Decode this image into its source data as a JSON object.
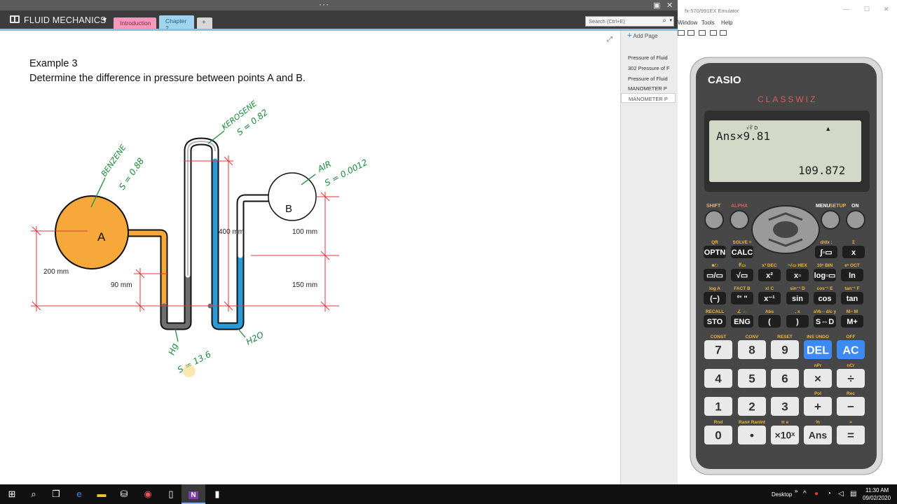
{
  "onenote": {
    "notebook_title": "FLUID MECHANICS",
    "sections": [
      "Introduction",
      "Chapter 2",
      "+"
    ],
    "search_placeholder": "Search (Ctrl+E)",
    "add_page_label": "Add Page",
    "pages": [
      "Pressure of Fluid",
      "302 Pressure of F",
      "Pressure of Fluid",
      "MANOMETER P",
      "MANOMETER P"
    ],
    "selected_page_index": 4,
    "page": {
      "heading": "Example 3",
      "problem": "Determine the difference in pressure between points A and B.",
      "diagram": {
        "point_a": "A",
        "point_b": "B",
        "dimensions": [
          "200 mm",
          "90 mm",
          "400 mm",
          "100 mm",
          "150 mm"
        ],
        "handwritten": [
          "BENZENE",
          "S = 0.88",
          "KEROSENE",
          "S = 0.82",
          "AIR",
          "S = 0.0012",
          "Hg",
          "S = 13.6",
          "H2O"
        ],
        "colors": {
          "benzene": "#f7a83a",
          "water": "#2a9bd7",
          "mercury": "#6e6e6e",
          "air": "#ffffff",
          "dimension_lines": "#e2343e",
          "ink": "#1a8a3a"
        }
      }
    }
  },
  "emulator": {
    "window_title": "fx-570/991EX Emulator",
    "menu": [
      "Window",
      "Tools",
      "Help"
    ],
    "calculator": {
      "brand": "CASIO",
      "model": "CLASSWIZ",
      "display_input": "Ans×9.81",
      "display_result": "109.872",
      "display_indicator": "▲",
      "display_mode": "√∛ D",
      "top_labels": {
        "shift": "SHIFT",
        "alpha": "ALPHA",
        "menu": "MENU",
        "setup": "SETUP",
        "on": "ON"
      },
      "row1": [
        {
          "key": "OPTN",
          "top": "QR"
        },
        {
          "key": "CALC",
          "top": "SOLVE ="
        },
        {
          "key": "∫▫▭",
          "top": "d/dx  :"
        },
        {
          "key": "x",
          "top": "Σ"
        }
      ],
      "row2": [
        {
          "key": "▭/▭",
          "top": "■⁄□"
        },
        {
          "key": "√▭",
          "top": "∛▭"
        },
        {
          "key": "x²",
          "top": "x³  DEC"
        },
        {
          "key": "x▫",
          "top": "ⁿ√▭  HEX"
        },
        {
          "key": "log▫▭",
          "top": "10ˣ  BIN"
        },
        {
          "key": "ln",
          "top": "eˣ  OCT"
        }
      ],
      "row3": [
        {
          "key": "(−)",
          "top": "log  A"
        },
        {
          "key": "°' \"",
          "top": "FACT  B"
        },
        {
          "key": "x⁻¹",
          "top": "x!  C"
        },
        {
          "key": "sin",
          "top": "sin⁻¹  D"
        },
        {
          "key": "cos",
          "top": "cos⁻¹  E"
        },
        {
          "key": "tan",
          "top": "tan⁻¹  F"
        }
      ],
      "row4": [
        {
          "key": "STO",
          "top": "RECALL"
        },
        {
          "key": "ENG",
          "top": "∠  ←"
        },
        {
          "key": "(",
          "top": "Abs"
        },
        {
          "key": ")",
          "top": ",  x"
        },
        {
          "key": "S⇔D",
          "top": "a⅟b⇔d/c  y"
        },
        {
          "key": "M+",
          "top": "M−  M"
        }
      ],
      "num_row1": [
        {
          "key": "7",
          "top": "CONST"
        },
        {
          "key": "8",
          "top": "CONV"
        },
        {
          "key": "9",
          "top": "RESET"
        },
        {
          "key": "DEL",
          "top": "INS  UNDO"
        },
        {
          "key": "AC",
          "top": "OFF"
        }
      ],
      "num_row2": [
        {
          "key": "4",
          "top": ""
        },
        {
          "key": "5",
          "top": ""
        },
        {
          "key": "6",
          "top": ""
        },
        {
          "key": "×",
          "top": "nPr"
        },
        {
          "key": "÷",
          "top": "nCr"
        }
      ],
      "num_row3": [
        {
          "key": "1",
          "top": ""
        },
        {
          "key": "2",
          "top": ""
        },
        {
          "key": "3",
          "top": ""
        },
        {
          "key": "+",
          "top": "Pol"
        },
        {
          "key": "−",
          "top": "Rec"
        }
      ],
      "num_row4": [
        {
          "key": "0",
          "top": "Rnd"
        },
        {
          "key": "•",
          "top": "Ran#  RanInt"
        },
        {
          "key": "×10ˣ",
          "top": "π   e"
        },
        {
          "key": "Ans",
          "top": "%"
        },
        {
          "key": "=",
          "top": "≈"
        }
      ]
    }
  },
  "taskbar": {
    "desktop_label": "Desktop",
    "time": "11:30 AM",
    "date": "09/02/2020"
  }
}
